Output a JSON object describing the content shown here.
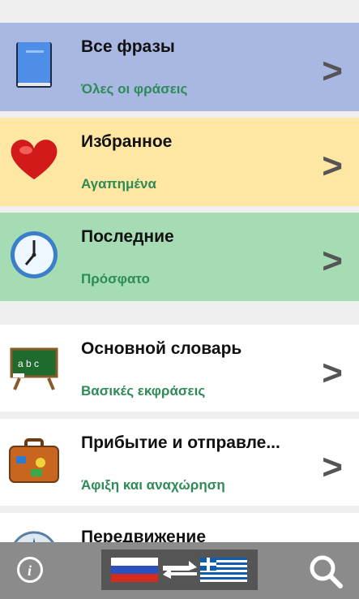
{
  "colors": {
    "row_all": "#a8b8e2",
    "row_fav": "#fde7a3",
    "row_recent": "#a5dcb4",
    "row_white": "#ffffff",
    "subtitle": "#2e8b57",
    "bottom_bar": "#8b8b8b"
  },
  "rows": [
    {
      "title": "Все фразы",
      "subtitle": "Όλες οι φράσεις",
      "icon": "book-icon"
    },
    {
      "title": "Избранное",
      "subtitle": "Αγαπημένα",
      "icon": "heart-icon"
    },
    {
      "title": "Последние",
      "subtitle": "Πρόσφατο",
      "icon": "clock-icon"
    },
    {
      "title": "Основной словарь",
      "subtitle": "Βασικές εκφράσεις",
      "icon": "chalkboard-icon"
    },
    {
      "title": "Прибытие и отправле...",
      "subtitle": "Άφιξη και αναχώρηση",
      "icon": "suitcase-icon"
    },
    {
      "title": "Передвижение",
      "subtitle": "",
      "icon": "compass-icon"
    }
  ],
  "chevron": ">",
  "bottom_bar": {
    "info_icon": "info-icon",
    "language_switch": "russia-greece-flags",
    "search_icon": "search-icon"
  }
}
